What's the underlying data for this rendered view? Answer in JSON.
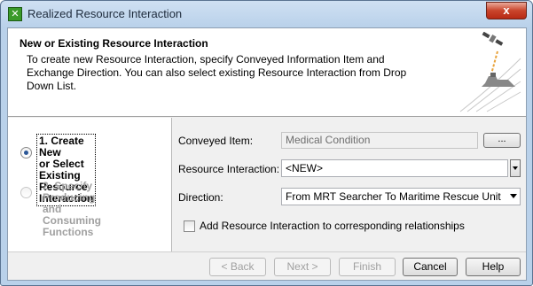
{
  "window": {
    "title": "Realized Resource Interaction",
    "close_label": "x"
  },
  "header": {
    "title": "New or Existing Resource Interaction",
    "description": "To create new Resource Interaction, specify Conveyed Information Item and Exchange Direction. You can also select existing Resource Interaction from Drop Down List."
  },
  "steps": [
    {
      "label_line1": "1. Create New",
      "label_line2": "or Select Existing",
      "label_line3": "Resource Interaction",
      "selected": true,
      "enabled": true
    },
    {
      "label_line1": "2. Specify Producing and",
      "label_line2": "Consuming Functions",
      "selected": false,
      "enabled": false
    }
  ],
  "form": {
    "conveyed_item_label": "Conveyed Item:",
    "conveyed_item_value": "Medical Condition",
    "browse_label": "...",
    "resource_interaction_label": "Resource Interaction:",
    "resource_interaction_value": "<NEW>",
    "direction_label": "Direction:",
    "direction_value": "From MRT Searcher To Maritime Rescue Unit",
    "add_checkbox_label": "Add Resource Interaction to corresponding relationships",
    "add_checkbox_checked": false
  },
  "footer": {
    "back_label": "< Back",
    "next_label": "Next >",
    "finish_label": "Finish",
    "cancel_label": "Cancel",
    "help_label": "Help"
  }
}
